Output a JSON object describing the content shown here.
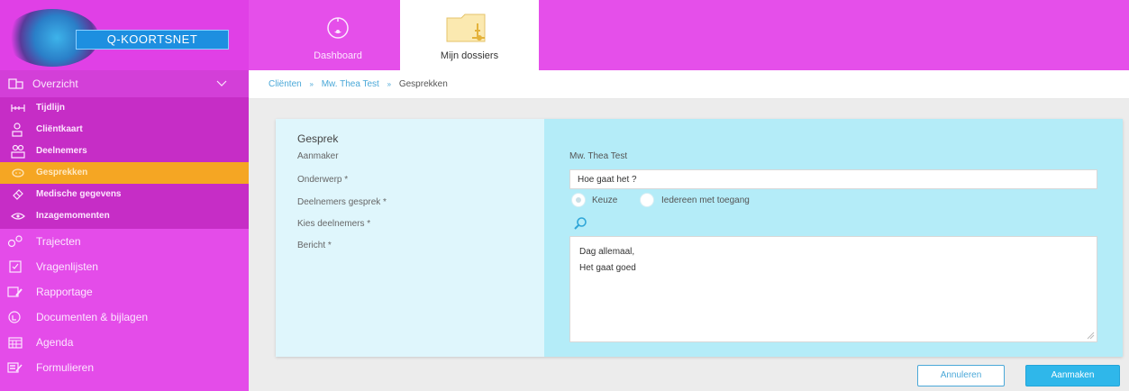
{
  "brand": {
    "logo_text": "Q-KOORTSNET"
  },
  "header": {
    "tabs": [
      {
        "label": "Dashboard",
        "icon": "dashboard-gauge-icon",
        "active": false
      },
      {
        "label": "Mijn dossiers",
        "icon": "folder-icon",
        "active": true
      }
    ]
  },
  "sidebar": {
    "overzicht": {
      "label": "Overzicht",
      "icon": "overview-icon",
      "expanded": true
    },
    "sub_items": [
      {
        "label": "Tijdlijn",
        "icon": "timeline-icon",
        "active": false
      },
      {
        "label": "Cliëntkaart",
        "icon": "client-card-icon",
        "active": false
      },
      {
        "label": "Deelnemers",
        "icon": "participants-icon",
        "active": false
      },
      {
        "label": "Gesprekken",
        "icon": "conversation-icon",
        "active": true
      },
      {
        "label": "Medische gegevens",
        "icon": "medical-icon",
        "active": false
      },
      {
        "label": "Inzagemomenten",
        "icon": "eye-icon",
        "active": false
      }
    ],
    "main_items": [
      {
        "label": "Trajecten",
        "icon": "trajectory-icon"
      },
      {
        "label": "Vragenlijsten",
        "icon": "checkbox-icon"
      },
      {
        "label": "Rapportage",
        "icon": "report-icon"
      },
      {
        "label": "Documenten & bijlagen",
        "icon": "documents-icon"
      },
      {
        "label": "Agenda",
        "icon": "calendar-icon"
      },
      {
        "label": "Formulieren",
        "icon": "form-icon"
      }
    ]
  },
  "breadcrumb": {
    "items": [
      "Cliënten",
      "Mw. Thea Test",
      "Gesprekken"
    ],
    "separator": "»"
  },
  "form": {
    "heading": "Gesprek",
    "labels": {
      "aanmaker": "Aanmaker",
      "onderwerp": "Onderwerp *",
      "deelnemers_gesprek": "Deelnemers gesprek *",
      "kies_deelnemers": "Kies deelnemers *",
      "bericht": "Bericht *"
    },
    "aanmaker_value": "Mw. Thea Test",
    "onderwerp_value": "Hoe gaat het ?",
    "radio_options": [
      {
        "label": "Keuze",
        "checked": true
      },
      {
        "label": "Iedereen met toegang",
        "checked": false
      }
    ],
    "bericht_lines": [
      "Dag allemaal,",
      "Het gaat goed"
    ]
  },
  "buttons": {
    "cancel": "Annuleren",
    "create": "Aanmaken"
  },
  "colors": {
    "magenta": "#e44ce9",
    "sidebar_dark": "#c62dc6",
    "active_orange": "#f5a623",
    "label_bg": "#dff6fc",
    "value_bg": "#b4ecf8",
    "primary_blue": "#2fb7ea"
  }
}
